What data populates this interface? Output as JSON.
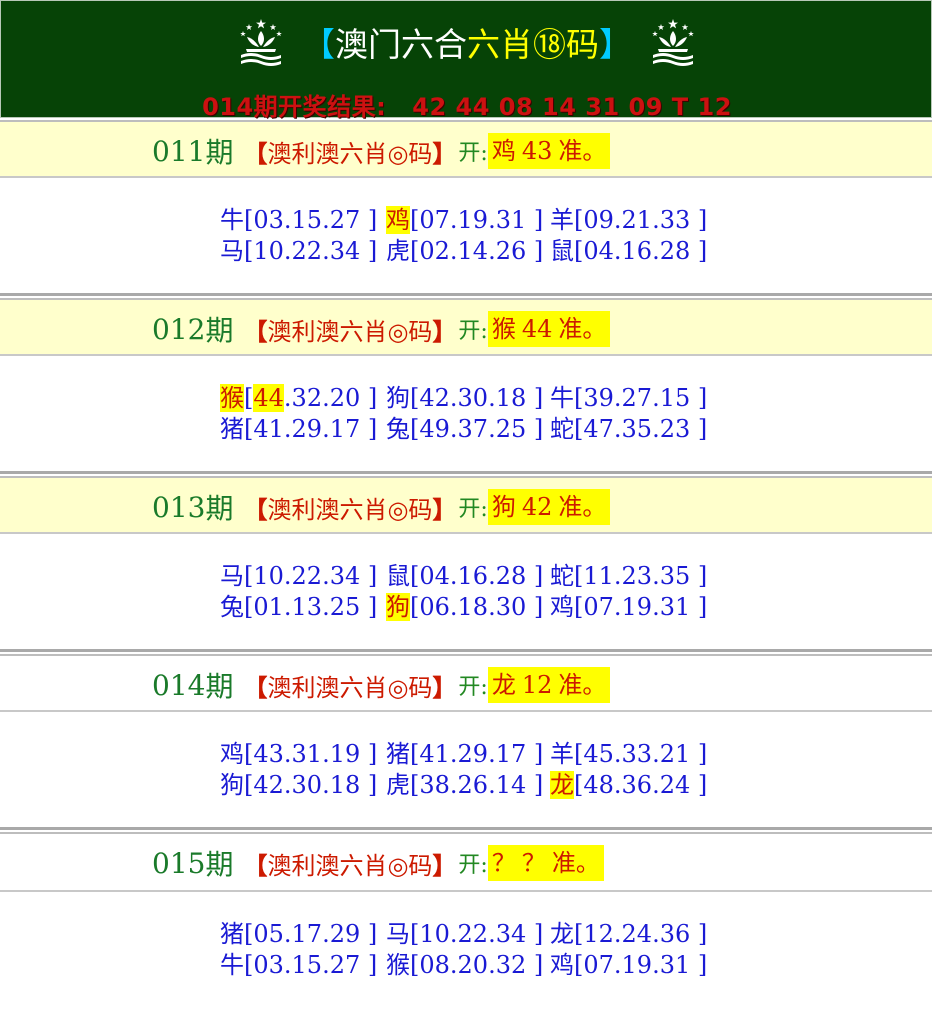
{
  "header": {
    "bracket_left": "【",
    "title_part1": "澳门六合",
    "title_hl": "六肖⑱码",
    "bracket_right": "】",
    "result_label": "014期开奖结果:",
    "result_numbers": "42 44 08 14 31 09 T 12",
    "emblem_icon": "macau-emblem-icon"
  },
  "periods": [
    {
      "number": "011",
      "suffix": "期",
      "tag_left": "【",
      "tag": "澳利澳六肖◎码",
      "tag_right": "】",
      "open_label": "开:",
      "answer_zodiac": "鸡",
      "answer_number": "43",
      "answer_suffix": "准。",
      "rows": [
        [
          {
            "z": "牛",
            "n": "[03.15.27 ]",
            "hl": false
          },
          {
            "z": "鸡",
            "n": "[07.19.31 ]",
            "hl": true
          },
          {
            "z": "羊",
            "n": "[09.21.33 ]",
            "hl": false
          }
        ],
        [
          {
            "z": "马",
            "n": "[10.22.34 ]",
            "hl": false
          },
          {
            "z": "虎",
            "n": "[02.14.26 ]",
            "hl": false
          },
          {
            "z": "鼠",
            "n": "[04.16.28 ]",
            "hl": false
          }
        ]
      ]
    },
    {
      "number": "012",
      "suffix": "期",
      "tag_left": "【",
      "tag": "澳利澳六肖◎码",
      "tag_right": "】",
      "open_label": "开:",
      "answer_zodiac": "猴",
      "answer_number": "44",
      "answer_suffix": "准。",
      "rows": [
        [
          {
            "z": "猴",
            "first": "44",
            "rest": ".32.20 ]",
            "lead": "[",
            "hl": true
          },
          {
            "z": "狗",
            "n": "[42.30.18 ]",
            "hl": false
          },
          {
            "z": "牛",
            "n": "[39.27.15 ]",
            "hl": false
          }
        ],
        [
          {
            "z": "猪",
            "n": "[41.29.17 ]",
            "hl": false
          },
          {
            "z": "兔",
            "n": "[49.37.25 ]",
            "hl": false
          },
          {
            "z": "蛇",
            "n": "[47.35.23 ]",
            "hl": false
          }
        ]
      ]
    },
    {
      "number": "013",
      "suffix": "期",
      "tag_left": "【",
      "tag": "澳利澳六肖◎码",
      "tag_right": "】",
      "open_label": "开:",
      "answer_zodiac": "狗",
      "answer_number": "42",
      "answer_suffix": "准。",
      "rows": [
        [
          {
            "z": "马",
            "n": "[10.22.34 ]",
            "hl": false
          },
          {
            "z": "鼠",
            "n": "[04.16.28 ]",
            "hl": false
          },
          {
            "z": "蛇",
            "n": "[11.23.35 ]",
            "hl": false
          }
        ],
        [
          {
            "z": "兔",
            "n": "[01.13.25 ]",
            "hl": false
          },
          {
            "z": "狗",
            "n": "[06.18.30 ]",
            "hl": true
          },
          {
            "z": "鸡",
            "n": "[07.19.31 ]",
            "hl": false
          }
        ]
      ]
    },
    {
      "number": "014",
      "suffix": "期",
      "tag_left": "【",
      "tag": "澳利澳六肖◎码",
      "tag_right": "】",
      "open_label": "开:",
      "answer_zodiac": "龙",
      "answer_number": "12",
      "answer_suffix": "准。",
      "rows": [
        [
          {
            "z": "鸡",
            "n": "[43.31.19 ]",
            "hl": false
          },
          {
            "z": "猪",
            "n": "[41.29.17 ]",
            "hl": false
          },
          {
            "z": "羊",
            "n": "[45.33.21 ]",
            "hl": false
          }
        ],
        [
          {
            "z": "狗",
            "n": "[42.30.18 ]",
            "hl": false
          },
          {
            "z": "虎",
            "n": "[38.26.14 ]",
            "hl": false
          },
          {
            "z": "龙",
            "n": "[48.36.24 ]",
            "hl": true
          }
        ]
      ]
    },
    {
      "number": "015",
      "suffix": "期",
      "tag_left": "【",
      "tag": "澳利澳六肖◎码",
      "tag_right": "】",
      "open_label": "开:",
      "answer_zodiac": "？",
      "answer_number": "？",
      "answer_suffix": "准。",
      "rows": [
        [
          {
            "z": "猪",
            "n": "[05.17.29 ]",
            "hl": false
          },
          {
            "z": "马",
            "n": "[10.22.34 ]",
            "hl": false
          },
          {
            "z": "龙",
            "n": "[12.24.36 ]",
            "hl": false
          }
        ],
        [
          {
            "z": "牛",
            "n": "[03.15.27 ]",
            "hl": false
          },
          {
            "z": "猴",
            "n": "[08.20.32 ]",
            "hl": false
          },
          {
            "z": "鸡",
            "n": "[07.19.31 ]",
            "hl": false
          }
        ]
      ]
    }
  ],
  "colors": {
    "header_bg": "#064306",
    "period_green": "#1a7a2a",
    "tag_red": "#cc1a00",
    "number_blue": "#1a1ad4",
    "highlight_yellow": "#ffff00",
    "row_yellow": "#ffffcc"
  }
}
